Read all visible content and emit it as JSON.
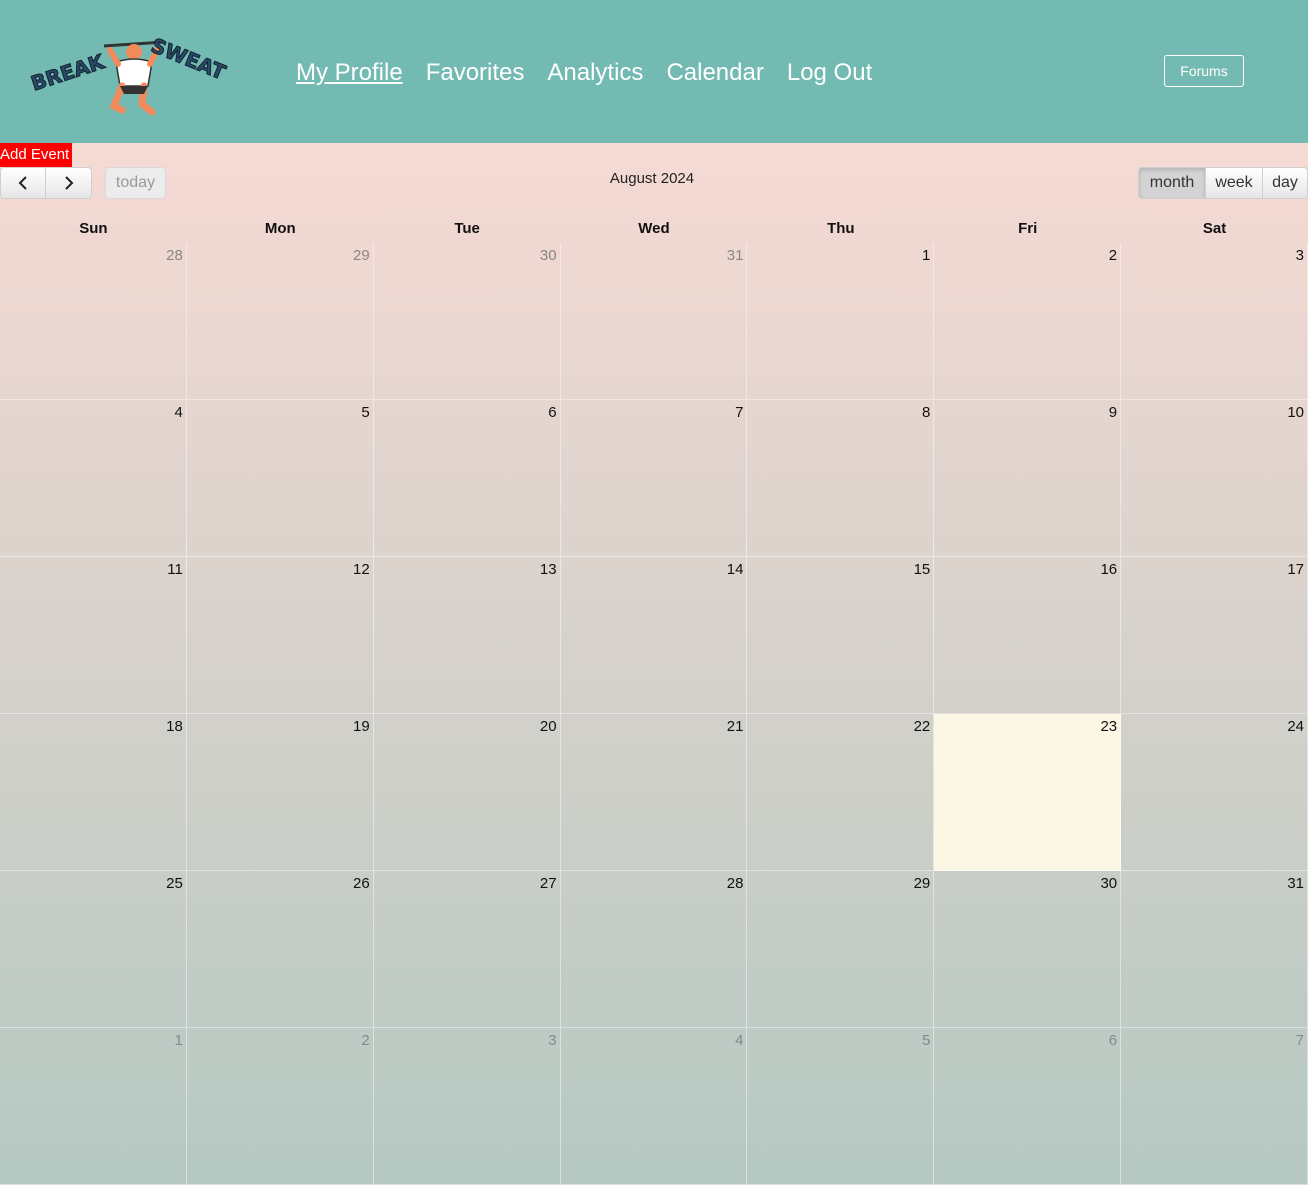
{
  "header": {
    "logo_text": "BREAK A SWEAT",
    "nav": [
      {
        "label": "My Profile",
        "active": true
      },
      {
        "label": "Favorites",
        "active": false
      },
      {
        "label": "Analytics",
        "active": false
      },
      {
        "label": "Calendar",
        "active": false
      },
      {
        "label": "Log Out",
        "active": false
      }
    ],
    "forums_label": "Forums",
    "bg_color": "#73bbb2"
  },
  "toolbar": {
    "add_event_label": "Add Event",
    "prev_icon": "chevron-left-icon",
    "next_icon": "chevron-right-icon",
    "today_label": "today",
    "title": "August 2024",
    "views": [
      "month",
      "week",
      "day"
    ],
    "active_view": "month"
  },
  "calendar": {
    "weekdays": [
      "Sun",
      "Mon",
      "Tue",
      "Wed",
      "Thu",
      "Fri",
      "Sat"
    ],
    "today": "23",
    "today_color": "#fcf7e4",
    "weeks": [
      [
        {
          "d": "28",
          "o": true
        },
        {
          "d": "29",
          "o": true
        },
        {
          "d": "30",
          "o": true
        },
        {
          "d": "31",
          "o": true
        },
        {
          "d": "1"
        },
        {
          "d": "2"
        },
        {
          "d": "3"
        }
      ],
      [
        {
          "d": "4"
        },
        {
          "d": "5"
        },
        {
          "d": "6"
        },
        {
          "d": "7"
        },
        {
          "d": "8"
        },
        {
          "d": "9"
        },
        {
          "d": "10"
        }
      ],
      [
        {
          "d": "11"
        },
        {
          "d": "12"
        },
        {
          "d": "13"
        },
        {
          "d": "14"
        },
        {
          "d": "15"
        },
        {
          "d": "16"
        },
        {
          "d": "17"
        }
      ],
      [
        {
          "d": "18"
        },
        {
          "d": "19"
        },
        {
          "d": "20"
        },
        {
          "d": "21"
        },
        {
          "d": "22"
        },
        {
          "d": "23",
          "t": true
        },
        {
          "d": "24"
        }
      ],
      [
        {
          "d": "25"
        },
        {
          "d": "26"
        },
        {
          "d": "27"
        },
        {
          "d": "28"
        },
        {
          "d": "29"
        },
        {
          "d": "30"
        },
        {
          "d": "31"
        }
      ],
      [
        {
          "d": "1",
          "o": true
        },
        {
          "d": "2",
          "o": true
        },
        {
          "d": "3",
          "o": true
        },
        {
          "d": "4",
          "o": true
        },
        {
          "d": "5",
          "o": true
        },
        {
          "d": "6",
          "o": true
        },
        {
          "d": "7",
          "o": true
        }
      ]
    ]
  }
}
